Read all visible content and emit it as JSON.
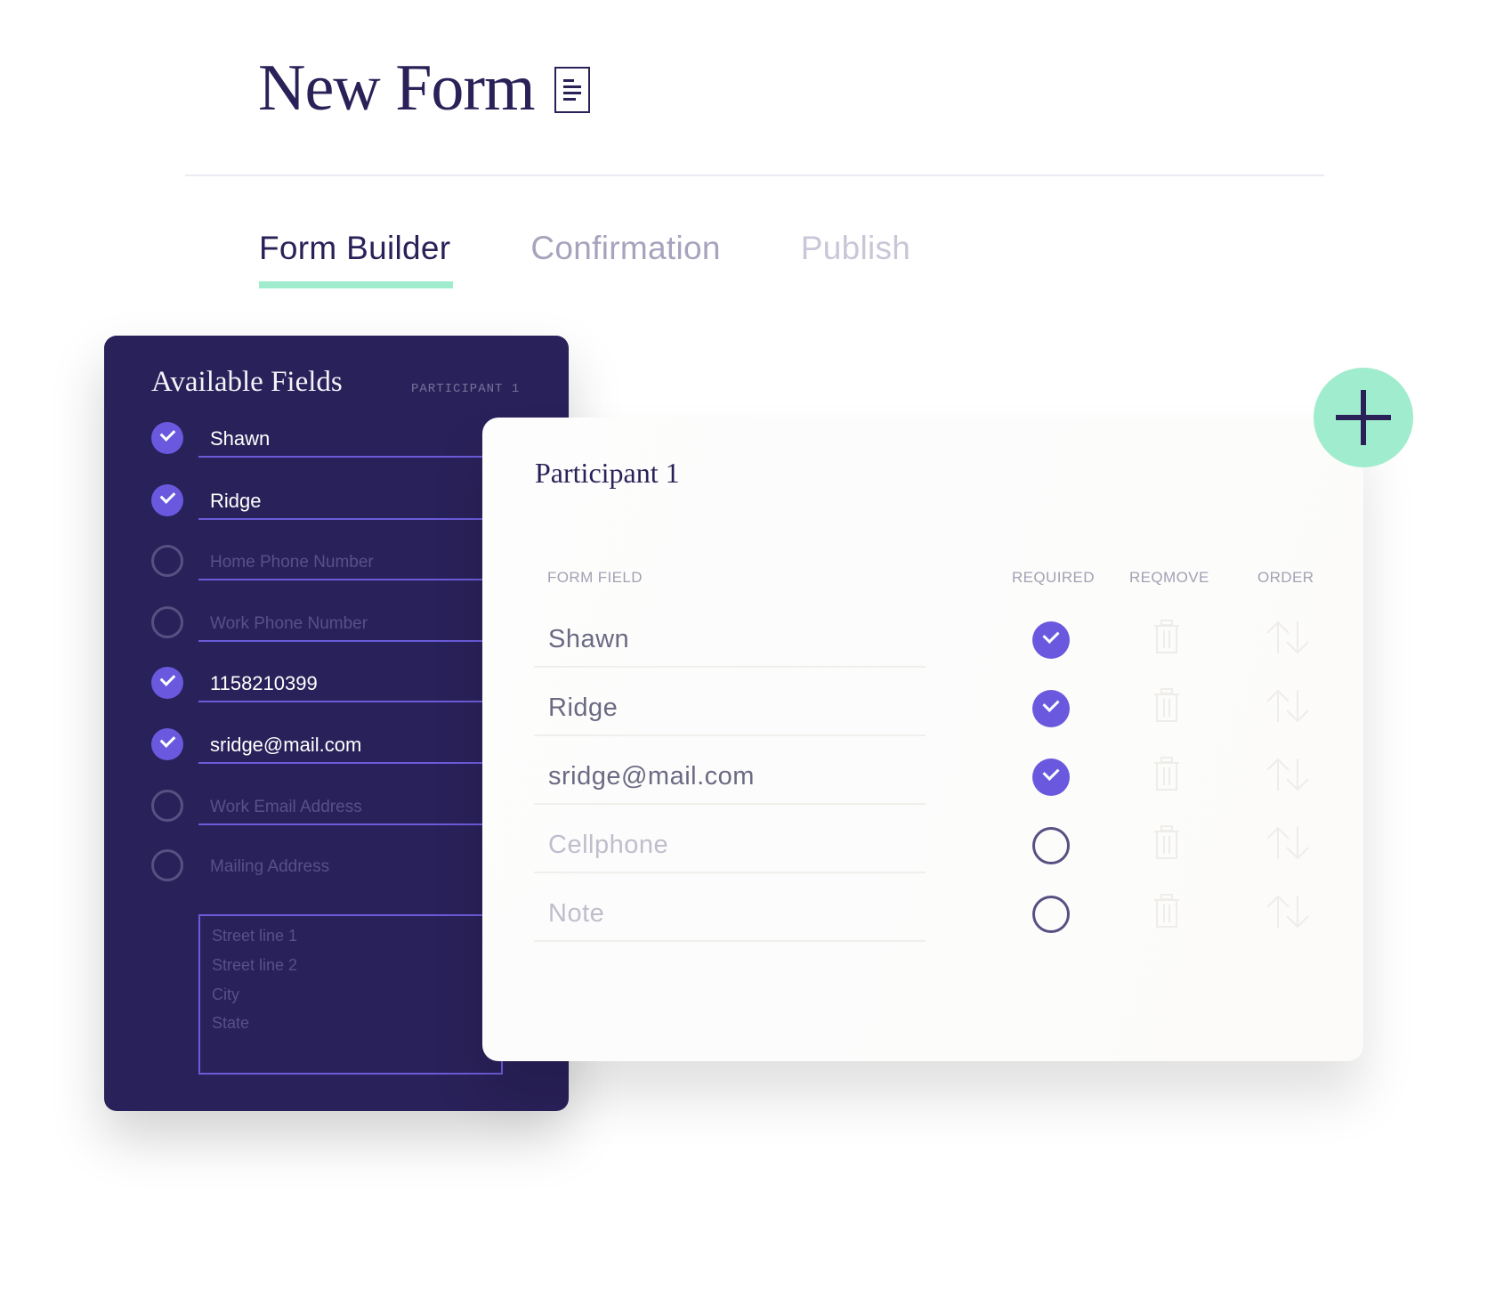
{
  "header": {
    "title": "New Form",
    "title_icon": "document-icon"
  },
  "tabs": [
    {
      "label": "Form Builder",
      "active": true
    },
    {
      "label": "Confirmation",
      "active": false
    },
    {
      "label": "Publish",
      "active": false
    }
  ],
  "available_fields": {
    "title": "Available Fields",
    "participant_label": "PARTICIPANT 1",
    "items": [
      {
        "text": "Shawn",
        "checked": true,
        "is_placeholder": false
      },
      {
        "text": "Ridge",
        "checked": true,
        "is_placeholder": false
      },
      {
        "text": "Home Phone Number",
        "checked": false,
        "is_placeholder": true
      },
      {
        "text": "Work Phone Number",
        "checked": false,
        "is_placeholder": true
      },
      {
        "text": "1158210399",
        "checked": true,
        "is_placeholder": false
      },
      {
        "text": "sridge@mail.com",
        "checked": true,
        "is_placeholder": false
      },
      {
        "text": "Work Email Address",
        "checked": false,
        "is_placeholder": true
      },
      {
        "text": "Mailing Address",
        "checked": false,
        "is_placeholder": true
      }
    ],
    "address_lines": [
      "Street line 1",
      "Street line 2",
      "City",
      "State"
    ]
  },
  "participant": {
    "title": "Participant 1",
    "columns": [
      "FORM FIELD",
      "REQUIRED",
      "REQMOVE",
      "ORDER"
    ],
    "rows": [
      {
        "field": "Shawn",
        "required": true,
        "is_placeholder": false
      },
      {
        "field": "Ridge",
        "required": true,
        "is_placeholder": false
      },
      {
        "field": "sridge@mail.com",
        "required": true,
        "is_placeholder": false
      },
      {
        "field": "Cellphone",
        "required": false,
        "is_placeholder": true
      },
      {
        "field": "Note",
        "required": false,
        "is_placeholder": true
      }
    ]
  },
  "add_button": {
    "icon": "plus-icon"
  },
  "colors": {
    "navy": "#2a2158",
    "panel": "#292159",
    "accent_purple": "#6a59de",
    "mint": "#a0ecce"
  }
}
